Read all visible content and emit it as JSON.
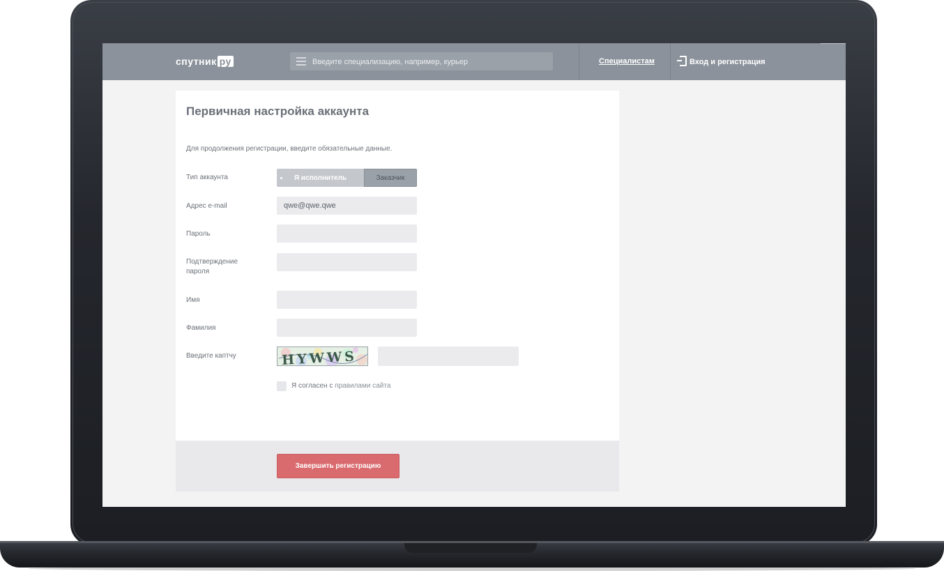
{
  "header": {
    "logo_text": "спутник",
    "logo_badge": "ру",
    "search_placeholder": "Введите специализацию, например, курьер",
    "specialists_link": "Специалистам",
    "login_link": "Вход и регистрация"
  },
  "form": {
    "title": "Первичная настройка аккаунта",
    "intro": "Для продолжения регистрации, введите обязательные данные.",
    "account_type_label": "Тип аккаунта",
    "account_type_options": [
      "Я исполнитель",
      "Заказчик"
    ],
    "email_label": "Адрес e-mail",
    "email_value": "qwe@qwe.qwe",
    "password_label": "Пароль",
    "password_confirm_label_1": "Подтверждение",
    "password_confirm_label_2": "пароля",
    "first_name_label": "Имя",
    "last_name_label": "Фамилия",
    "captcha_label": "Введите каптчу",
    "captcha_text": "HYWWS",
    "agree_text": "Я согласен с",
    "agree_link": "правилами сайта",
    "submit_label": "Завершить регистрацию"
  },
  "colors": {
    "header_bg": "#8b929b",
    "submit_bg": "#d96a6e",
    "field_bg": "#ebebee"
  }
}
